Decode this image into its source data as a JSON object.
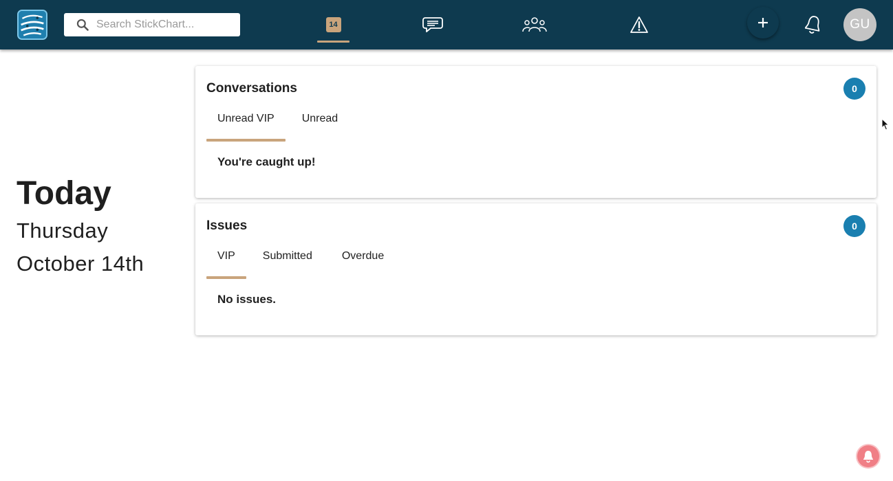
{
  "header": {
    "search": {
      "placeholder": "Search StickChart..."
    },
    "nav": [
      {
        "name": "calendar",
        "icon": "calendar-icon",
        "day_number": "14",
        "active": true
      },
      {
        "name": "conversations",
        "icon": "chat-icon",
        "active": false
      },
      {
        "name": "people",
        "icon": "people-icon",
        "active": false
      },
      {
        "name": "issues",
        "icon": "warning-icon",
        "active": false
      }
    ],
    "avatar_initials": "GU"
  },
  "date_panel": {
    "heading": "Today",
    "weekday": "Thursday",
    "date": "October 14th"
  },
  "conversations_card": {
    "title": "Conversations",
    "count": "0",
    "tabs": [
      "Unread VIP",
      "Unread"
    ],
    "active_tab": 0,
    "empty_message": "You're caught up!"
  },
  "issues_card": {
    "title": "Issues",
    "count": "0",
    "tabs": [
      "VIP",
      "Submitted",
      "Overdue"
    ],
    "active_tab": 0,
    "empty_message": "No issues."
  },
  "colors": {
    "header_bg": "#0e3a4f",
    "accent_tan": "#c9a47c",
    "badge_blue": "#1a7fb0",
    "avatar_gray": "#c4c4c4",
    "help_red": "#f07f86"
  }
}
